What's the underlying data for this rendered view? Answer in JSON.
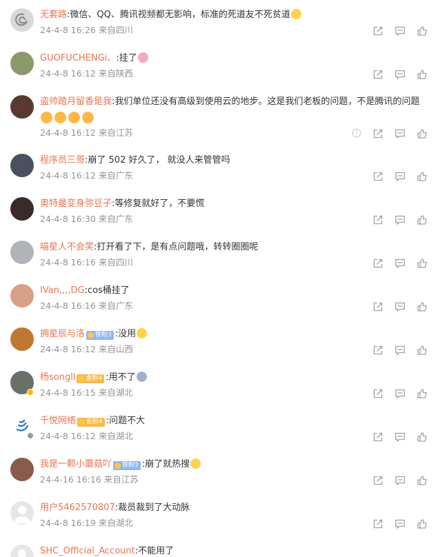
{
  "colors": {
    "username": "#eb7350",
    "text": "#333333",
    "meta": "#939393",
    "icon": "#a0a0a0"
  },
  "comments": [
    {
      "user": "无套路",
      "text": "微信、QQ、腾讯视频都无影响，标准的死道友不死贫道",
      "emojis_after": [
        "laugh-emoji"
      ],
      "time": "24-4-8 16:26",
      "location": "来自四川",
      "avatar_color": "#d8d8d8",
      "avatar_icon": "debian-swirl-avatar"
    },
    {
      "user": "GUOFUCHENGi、",
      "text": "挂了",
      "emojis_after": [
        "pig-emoji"
      ],
      "time": "24-4-8 16:12",
      "location": "来自陕西",
      "avatar_color": "#8a9a6a"
    },
    {
      "user": "盗帅踏月留香是我",
      "text": "我们单位还没有高级到使用云的地步。这是我们老板的问题，不是腾讯的问题",
      "emojis_below": [
        "shy-emoji",
        "shy-emoji",
        "shy-emoji",
        "shy-emoji"
      ],
      "time": "24-4-8 16:12",
      "location": "来自江苏",
      "avatar_color": "#5a3a30",
      "has_report": true
    },
    {
      "user": "程序员三哥",
      "text": "崩了 502 好久了， 就没人来管管吗",
      "time": "24-4-8 16:12",
      "location": "来自广东",
      "avatar_color": "#4a5060"
    },
    {
      "user": "奥特曼变身弥豆子",
      "text": "等修复就好了，不要慌",
      "time": "24-4-8 16:30",
      "location": "来自广东",
      "avatar_color": "#3a2a2a"
    },
    {
      "user": "喵星人不会笑",
      "text": "打开看了下，是有点问题哦，转转圈圈呢",
      "time": "24-4-8 16:16",
      "location": "来自四川",
      "avatar_color": "#b0b4b8"
    },
    {
      "user": "IVan,,,,DG",
      "text": "cos桶挂了",
      "time": "24-4-8 16:16",
      "location": "来自广东",
      "avatar_color": "#d9a088"
    },
    {
      "user": "拥星辰与洛",
      "fan_badge": "铁粉3",
      "fan_style": "blue",
      "text": "没用",
      "emojis_after": [
        "sweat-emoji"
      ],
      "time": "24-4-8 16:12",
      "location": "来自山西",
      "avatar_color": "#c07830"
    },
    {
      "user": "杨songll",
      "fan_badge": "金粉4",
      "fan_style": "gold",
      "text": "用不了",
      "emojis_after": [
        "cry-emoji"
      ],
      "time": "24-4-8 16:15",
      "location": "来自湖北",
      "avatar_color": "#6a7068",
      "verified": "gold"
    },
    {
      "user": "千悦网络",
      "fan_badge": "金粉4",
      "fan_style": "gold",
      "text": "问题不大",
      "time": "24-4-8 16:12",
      "location": "来自湖北",
      "avatar_color": "#ffffff",
      "avatar_icon": "qianyue-logo-avatar",
      "verified": "gray"
    },
    {
      "user": "我是一颗小蘑菇吖",
      "fan_badge": "铁粉3",
      "fan_style": "blue",
      "text": "崩了就热搜",
      "emojis_after": [
        "laugh-emoji"
      ],
      "time": "24-4-16 16:16",
      "location": "来自江苏",
      "avatar_color": "#8a5a4a"
    },
    {
      "user": "用户5462570807",
      "text": "裁员裁到了大动脉",
      "time": "24-4-8 16:19",
      "location": "来自湖北",
      "avatar_color": "#e6e6e6",
      "avatar_icon": "default-user-avatar"
    },
    {
      "user": "SHC_Official_Account",
      "text": "不能用了",
      "time": "",
      "location": "",
      "avatar_color": "#e6e6e6",
      "avatar_icon": "default-user-avatar"
    }
  ],
  "action_icons": [
    "share-icon",
    "comment-icon",
    "like-icon"
  ]
}
